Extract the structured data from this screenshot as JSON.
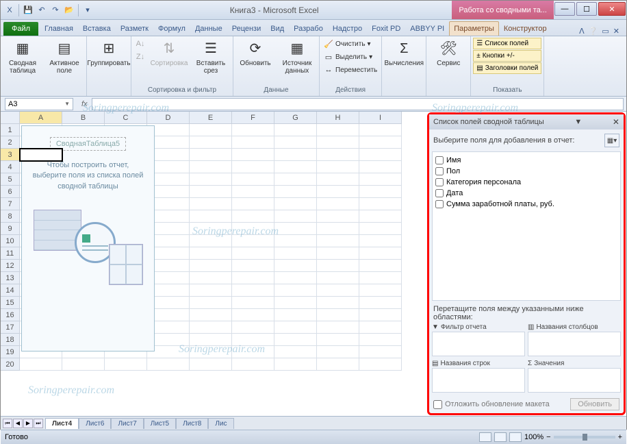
{
  "title": {
    "document": "Книга3",
    "app": "Microsoft Excel",
    "pivot_context": "Работа со сводными та..."
  },
  "qat": [
    "save",
    "undo",
    "redo",
    "open"
  ],
  "tabs": {
    "file": "Файл",
    "items": [
      "Главная",
      "Вставка",
      "Разметк",
      "Формул",
      "Данные",
      "Рецензи",
      "Вид",
      "Разрабо",
      "Надстро",
      "Foxit PD",
      "ABBYY PI"
    ],
    "pivot": [
      "Параметры",
      "Конструктор"
    ]
  },
  "ribbon": {
    "g1": {
      "title": "",
      "btns": {
        "pivot": "Сводная\nтаблица",
        "active": "Активное\nполе"
      }
    },
    "g2": {
      "title": "",
      "btns": {
        "group": "Группировать"
      }
    },
    "g3": {
      "title": "Сортировка и фильтр",
      "btns": {
        "sort": "Сортировка",
        "slicer": "Вставить\nсрез"
      }
    },
    "g4": {
      "title": "Данные",
      "btns": {
        "refresh": "Обновить",
        "source": "Источник\nданных"
      }
    },
    "g5": {
      "title": "Действия",
      "btns": {
        "clear": "Очистить",
        "select": "Выделить",
        "move": "Переместить"
      }
    },
    "g6": {
      "title": "",
      "btns": {
        "calc": "Вычисления"
      }
    },
    "g7": {
      "title": "",
      "btns": {
        "tools": "Сервис"
      }
    },
    "g8": {
      "title": "Показать",
      "btns": {
        "fieldlist": "Список полей",
        "pmbuttons": "Кнопки +/-",
        "headers": "Заголовки полей"
      }
    }
  },
  "namebox": "A3",
  "fx": "fx",
  "columns": [
    "A",
    "B",
    "C",
    "D",
    "E",
    "F",
    "G",
    "H",
    "I"
  ],
  "row_count": 20,
  "selected_cell": {
    "row": 3,
    "col": "A"
  },
  "pivot_ph": {
    "name": "СводнаяТаблица5",
    "text": "Чтобы построить отчет, выберите поля из списка полей сводной таблицы"
  },
  "fieldlist": {
    "title": "Список полей сводной таблицы",
    "subtitle": "Выберите поля для добавления в отчет:",
    "fields": [
      "Имя",
      "Пол",
      "Категория персонала",
      "Дата",
      "Сумма заработной платы, руб."
    ],
    "drag_text": "Перетащите поля между указанными ниже областями:",
    "zones": {
      "filter": "Фильтр отчета",
      "cols": "Названия столбцов",
      "rows": "Названия строк",
      "values": "Значения"
    },
    "defer": "Отложить обновление макета",
    "update": "Обновить"
  },
  "sheets": {
    "active": "Лист4",
    "others": [
      "Лист6",
      "Лист7",
      "Лист5",
      "Лист8",
      "Лис"
    ]
  },
  "status": {
    "ready": "Готово",
    "zoom": "100%"
  },
  "watermark": "Soringperepair.com"
}
